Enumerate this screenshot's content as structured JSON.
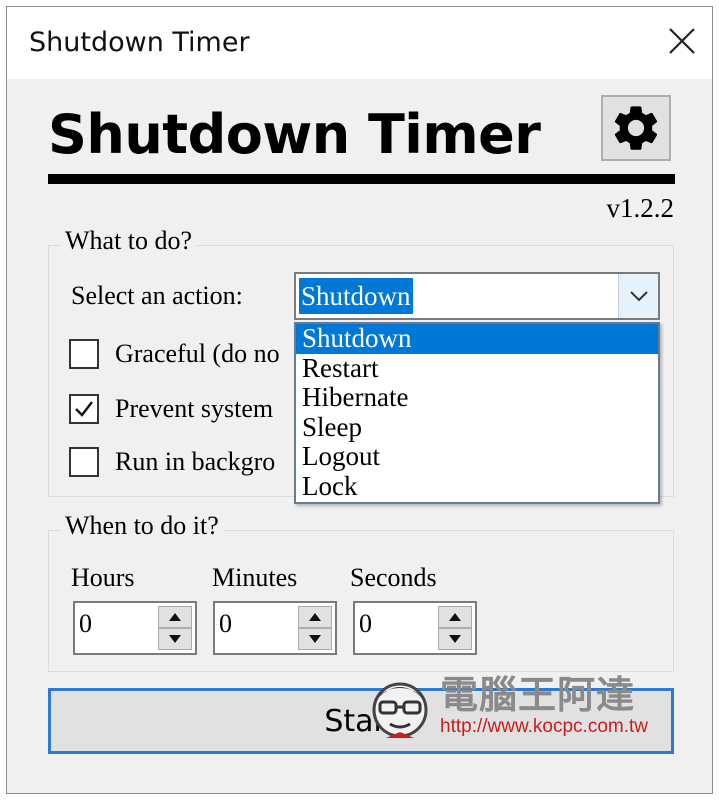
{
  "window": {
    "title": "Shutdown Timer"
  },
  "header": {
    "app_title": "Shutdown Timer",
    "version": "v1.2.2"
  },
  "what_group": {
    "legend": "What to do?",
    "action_label": "Select an action:",
    "action_selected": "Shutdown",
    "actions": [
      "Shutdown",
      "Restart",
      "Hibernate",
      "Sleep",
      "Logout",
      "Lock"
    ],
    "options": [
      {
        "label": "Graceful (do no",
        "checked": false
      },
      {
        "label": "Prevent system",
        "checked": true
      },
      {
        "label": "Run in backgro",
        "checked": false
      }
    ]
  },
  "when_group": {
    "legend": "When to do it?",
    "fields": [
      {
        "label": "Hours",
        "value": "0"
      },
      {
        "label": "Minutes",
        "value": "0"
      },
      {
        "label": "Seconds",
        "value": "0"
      }
    ]
  },
  "start_label": "Start",
  "watermark": {
    "name": "電腦王阿達",
    "url": "http://www.kocpc.com.tw"
  },
  "colors": {
    "accent": "#0078d7",
    "start_border": "#2a7ad6",
    "window_bg": "#f0f0f0"
  }
}
